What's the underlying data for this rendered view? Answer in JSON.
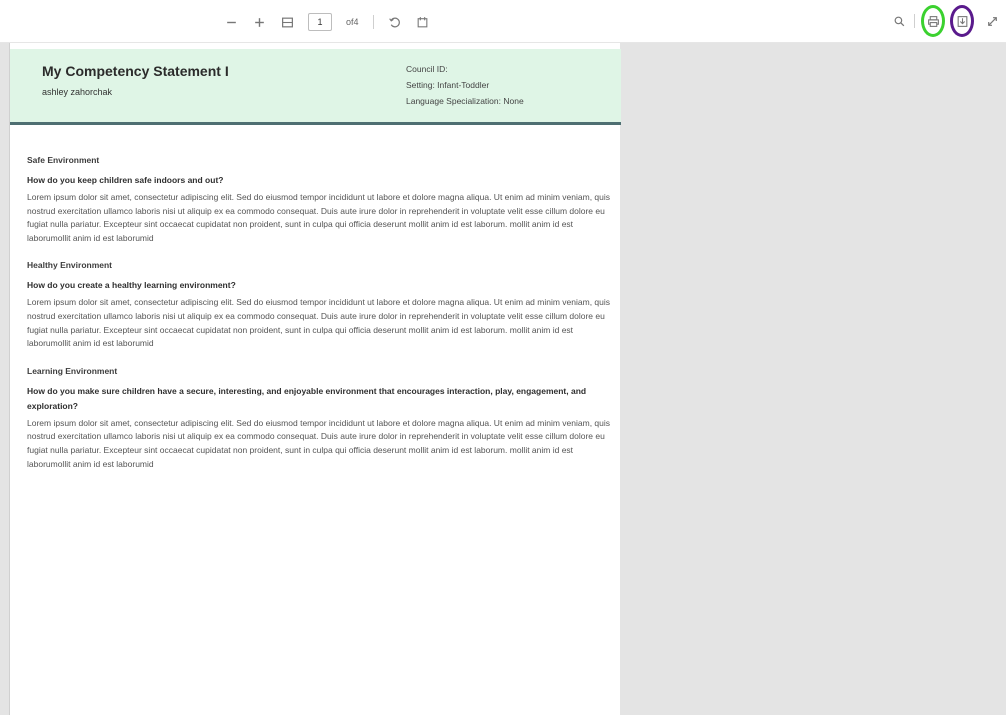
{
  "toolbar": {
    "page_number": "1",
    "page_total": "of4",
    "icons": [
      "minus-icon",
      "plus-icon",
      "fit-page-icon",
      "rotate-icon",
      "history-icon",
      "search-icon",
      "print-icon",
      "download-icon",
      "expand-icon"
    ],
    "highlight_colors": {
      "print": "#3bd12f",
      "download": "#5a1a8c"
    }
  },
  "document": {
    "header": {
      "title": "My Competency Statement I",
      "author": "ashley zahorchak",
      "council_id": "Council ID:",
      "setting": "Setting: Infant-Toddler",
      "language": "Language Specialization: None",
      "bg_color": "#dff5e6",
      "rule_color": "#4e6f72"
    },
    "sections": [
      {
        "title": "Safe Environment",
        "question": "How do you keep children safe indoors and out?",
        "text": "Lorem ipsum dolor sit amet, consectetur adipiscing elit. Sed do eiusmod tempor incididunt ut labore et dolore magna aliqua. Ut enim ad minim veniam, quis nostrud exercitation ullamco laboris nisi ut aliquip ex ea commodo consequat. Duis aute irure dolor in reprehenderit in voluptate velit esse cillum dolore eu fugiat nulla pariatur. Excepteur sint occaecat cupidatat non proident, sunt in culpa qui officia deserunt mollit anim id est laborum. mollit anim id est laborumollit anim id est laborumid"
      },
      {
        "title": "Healthy Environment",
        "question": "How do you create a healthy learning environment?",
        "text": "Lorem ipsum dolor sit amet, consectetur adipiscing elit. Sed do eiusmod tempor incididunt ut labore et dolore magna aliqua. Ut enim ad minim veniam, quis nostrud exercitation ullamco laboris nisi ut aliquip ex ea commodo consequat. Duis aute irure dolor in reprehenderit in voluptate velit esse cillum dolore eu fugiat nulla pariatur. Excepteur sint occaecat cupidatat non proident, sunt in culpa qui officia deserunt mollit anim id est laborum. mollit anim id est laborumollit anim id est laborumid"
      },
      {
        "title": "Learning Environment",
        "question": "How do you make sure children have a secure, interesting, and enjoyable environment that encourages interaction, play, engagement, and exploration?",
        "text": "Lorem ipsum dolor sit amet, consectetur adipiscing elit. Sed do eiusmod tempor incididunt ut labore et dolore magna aliqua. Ut enim ad minim veniam, quis nostrud exercitation ullamco laboris nisi ut aliquip ex ea commodo consequat. Duis aute irure dolor in reprehenderit in voluptate velit esse cillum dolore eu fugiat nulla pariatur. Excepteur sint occaecat cupidatat non proident, sunt in culpa qui officia deserunt mollit anim id est laborum. mollit anim id est laborumollit anim id est laborumid"
      }
    ]
  }
}
